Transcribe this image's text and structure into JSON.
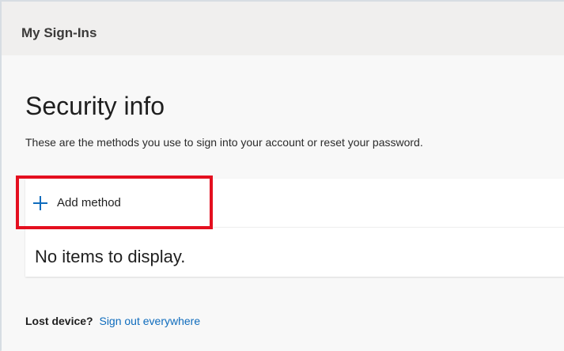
{
  "header": {
    "title": "My Sign-Ins"
  },
  "main": {
    "title": "Security info",
    "subtitle": "These are the methods you use to sign into your account or reset your password.",
    "add_method": {
      "label": "Add method",
      "icon": "plus-icon"
    },
    "empty_message": "No items to display.",
    "footer": {
      "lost_label": "Lost device?",
      "link_label": "Sign out everywhere"
    }
  },
  "colors": {
    "accent": "#0f6cbd",
    "highlight": "#e40f1f",
    "background": "#f3f2f1"
  }
}
